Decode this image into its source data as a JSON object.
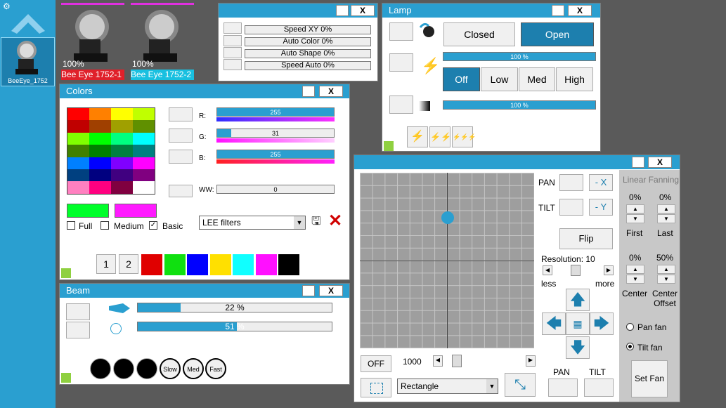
{
  "fixtures": [
    {
      "name": "Bee Eye 1752-1",
      "level": "100%",
      "label_bg": "#e0202a",
      "bar_color": "#e030e0"
    },
    {
      "name": "Bee Eye 1752-2",
      "level": "100%",
      "label_bg": "#19c0e0",
      "bar_color": "#e030e0"
    }
  ],
  "sidebar": {
    "device_label": "BeeEye_1752"
  },
  "speed_panel": {
    "rows": [
      {
        "label": "Speed XY",
        "value": "0%"
      },
      {
        "label": "Auto Color",
        "value": "0%"
      },
      {
        "label": "Auto Shape",
        "value": "0%"
      },
      {
        "label": "Speed Auto",
        "value": "0%"
      }
    ],
    "close": "X"
  },
  "lamp": {
    "title": "Lamp",
    "closed": "Closed",
    "open": "Open",
    "dimmer1": "100 %",
    "dimmer2": "100 %",
    "levels": [
      "Off",
      "Low",
      "Med",
      "High"
    ],
    "close": "X"
  },
  "colors": {
    "title": "Colors",
    "close": "X",
    "palette": [
      "#ff0000",
      "#ff8000",
      "#ffff00",
      "#c0ff00",
      "#c00000",
      "#a04000",
      "#a0a000",
      "#609000",
      "#80ff00",
      "#00ff00",
      "#00ff80",
      "#00ffff",
      "#408000",
      "#008000",
      "#008040",
      "#008080",
      "#0080ff",
      "#0000ff",
      "#8000ff",
      "#ff00ff",
      "#004080",
      "#000080",
      "#400080",
      "#800080",
      "#ff80c0",
      "#ff0080",
      "#800040",
      "#ffffff"
    ],
    "r_label": "R:",
    "r_value": "255",
    "g_label": "G:",
    "g_value": "31",
    "b_label": "B:",
    "b_value": "255",
    "ww_label": "WW:",
    "ww_value": "0",
    "current_color": "#00ff2a",
    "target_color": "#ff1aff",
    "opt_full": "Full",
    "opt_medium": "Medium",
    "opt_basic": "Basic",
    "filter": "LEE filters",
    "page1": "1",
    "page2": "2",
    "quick": [
      "#e00000",
      "#10e010",
      "#0000ff",
      "#ffe000",
      "#10ffff",
      "#ff10ff",
      "#000000"
    ]
  },
  "beam": {
    "title": "Beam",
    "close": "X",
    "bar1": "22 %",
    "bar2": "51 %",
    "speeds": [
      "Slow",
      "Med",
      "Fast"
    ]
  },
  "pantilt": {
    "close": "X",
    "pan": "PAN",
    "tilt": "TILT",
    "neg_x": "- X",
    "neg_y": "- Y",
    "flip": "Flip",
    "resolution": "Resolution: 10",
    "less": "less",
    "more": "more",
    "off": "OFF",
    "value": "1000",
    "shape": "Rectangle",
    "pan_btn": "PAN",
    "tilt_btn": "TILT",
    "fanning_title": "Linear Fanning",
    "first_val": "0%",
    "last_val": "0%",
    "first": "First",
    "last": "Last",
    "center_val": "0%",
    "offset_val": "50%",
    "center": "Center",
    "center_offset": "Center Offset",
    "pan_fan": "Pan fan",
    "tilt_fan": "Tilt fan",
    "set_fan": "Set Fan"
  }
}
